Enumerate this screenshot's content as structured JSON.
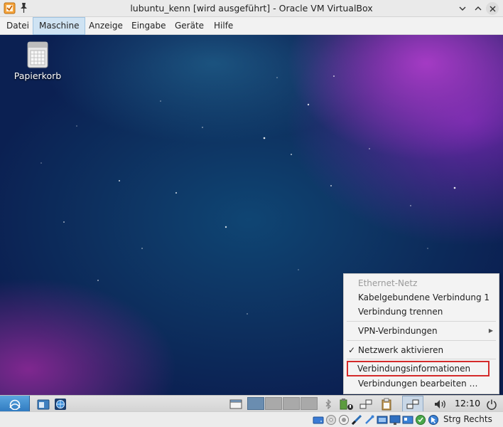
{
  "window": {
    "title": "lubuntu_kenn [wird ausgeführt] - Oracle VM VirtualBox"
  },
  "menubar": {
    "items": [
      {
        "label": "Datei",
        "active": false
      },
      {
        "label": "Maschine",
        "active": true
      },
      {
        "label": "Anzeige",
        "active": false
      },
      {
        "label": "Eingabe",
        "active": false
      },
      {
        "label": "Geräte",
        "active": false
      },
      {
        "label": "Hilfe",
        "active": false
      }
    ]
  },
  "desktop": {
    "icons": [
      {
        "label": "Papierkorb",
        "icon": "trash-icon"
      }
    ]
  },
  "network_menu": {
    "header": "Ethernet-Netz",
    "wired_connection": "Kabelgebundene Verbindung 1",
    "disconnect": "Verbindung trennen",
    "vpn": "VPN-Verbindungen",
    "enable_network": "Netzwerk aktivieren",
    "enable_network_checked": true,
    "connection_info": "Verbindungsinformationen",
    "edit_connections": "Verbindungen bearbeiten …",
    "highlight_color": "#d42a2a"
  },
  "taskbar": {
    "clock": "12:10",
    "active_workspace": 1
  },
  "statusbar": {
    "host_key": "Strg Rechts"
  }
}
